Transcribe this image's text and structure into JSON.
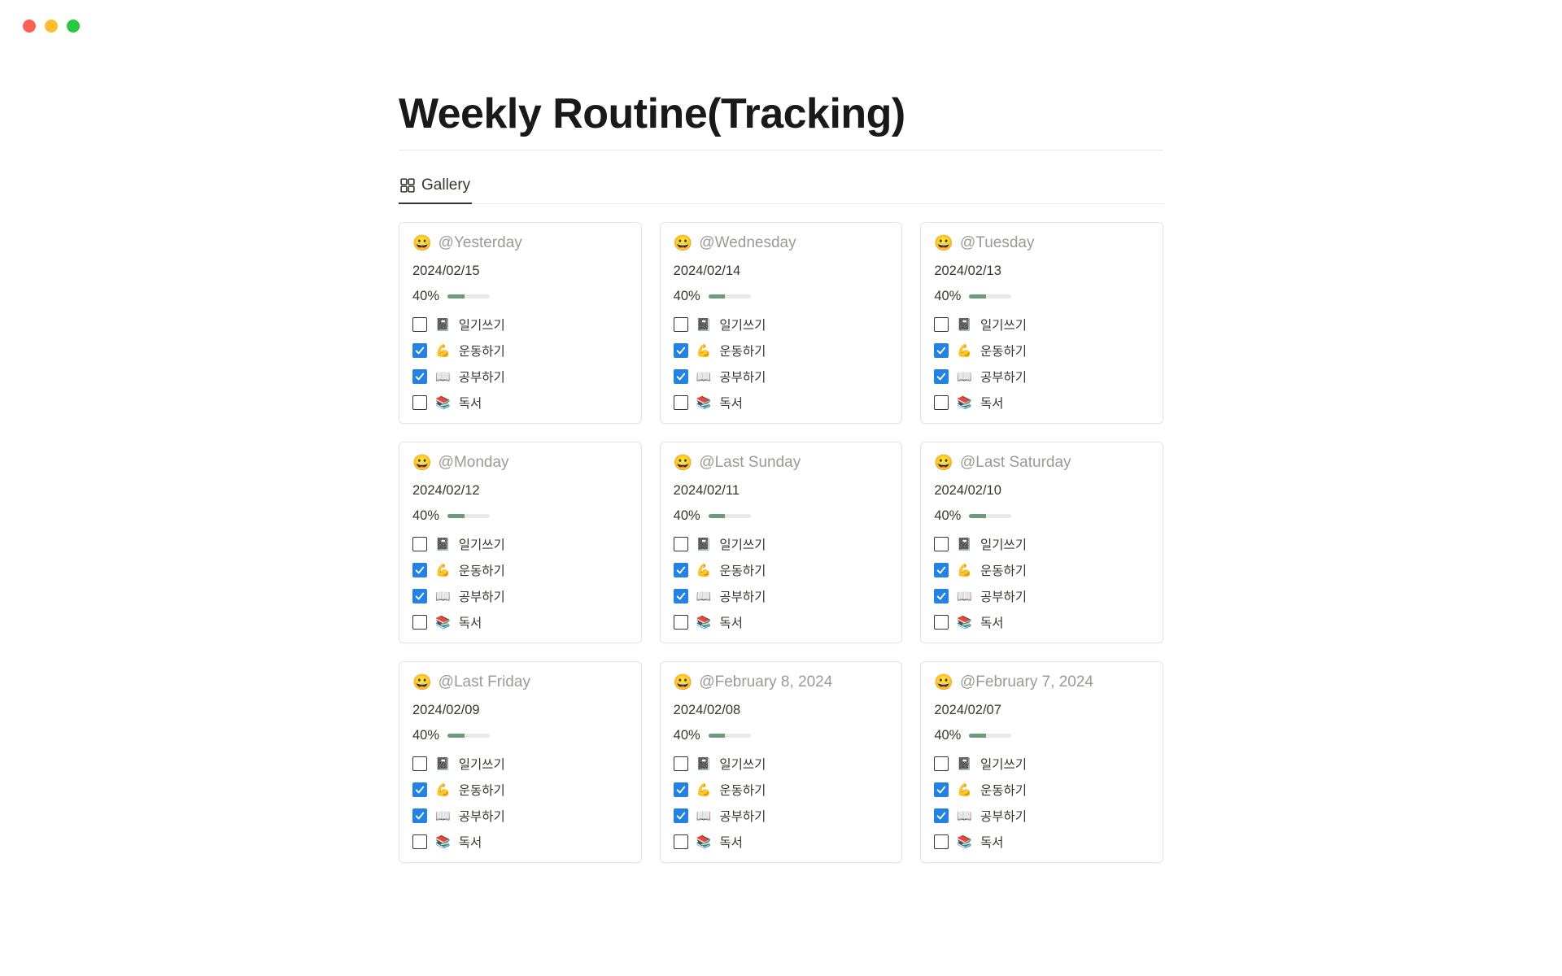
{
  "page": {
    "title": "Weekly Routine(Tracking)"
  },
  "tabs": {
    "gallery_label": "Gallery"
  },
  "cards": [
    {
      "emoji": "😀",
      "title": "@Yesterday",
      "date": "2024/02/15",
      "percent": "40%",
      "progress": 40,
      "tasks": [
        {
          "checked": false,
          "emoji": "📓",
          "text": "일기쓰기"
        },
        {
          "checked": true,
          "emoji": "💪",
          "text": "운동하기"
        },
        {
          "checked": true,
          "emoji": "📖",
          "text": "공부하기"
        },
        {
          "checked": false,
          "emoji": "📚",
          "text": "독서"
        }
      ]
    },
    {
      "emoji": "😀",
      "title": "@Wednesday",
      "date": "2024/02/14",
      "percent": "40%",
      "progress": 40,
      "tasks": [
        {
          "checked": false,
          "emoji": "📓",
          "text": "일기쓰기"
        },
        {
          "checked": true,
          "emoji": "💪",
          "text": "운동하기"
        },
        {
          "checked": true,
          "emoji": "📖",
          "text": "공부하기"
        },
        {
          "checked": false,
          "emoji": "📚",
          "text": "독서"
        }
      ]
    },
    {
      "emoji": "😀",
      "title": "@Tuesday",
      "date": "2024/02/13",
      "percent": "40%",
      "progress": 40,
      "tasks": [
        {
          "checked": false,
          "emoji": "📓",
          "text": "일기쓰기"
        },
        {
          "checked": true,
          "emoji": "💪",
          "text": "운동하기"
        },
        {
          "checked": true,
          "emoji": "📖",
          "text": "공부하기"
        },
        {
          "checked": false,
          "emoji": "📚",
          "text": "독서"
        }
      ]
    },
    {
      "emoji": "😀",
      "title": "@Monday",
      "date": "2024/02/12",
      "percent": "40%",
      "progress": 40,
      "tasks": [
        {
          "checked": false,
          "emoji": "📓",
          "text": "일기쓰기"
        },
        {
          "checked": true,
          "emoji": "💪",
          "text": "운동하기"
        },
        {
          "checked": true,
          "emoji": "📖",
          "text": "공부하기"
        },
        {
          "checked": false,
          "emoji": "📚",
          "text": "독서"
        }
      ]
    },
    {
      "emoji": "😀",
      "title": "@Last Sunday",
      "date": "2024/02/11",
      "percent": "40%",
      "progress": 40,
      "tasks": [
        {
          "checked": false,
          "emoji": "📓",
          "text": "일기쓰기"
        },
        {
          "checked": true,
          "emoji": "💪",
          "text": "운동하기"
        },
        {
          "checked": true,
          "emoji": "📖",
          "text": "공부하기"
        },
        {
          "checked": false,
          "emoji": "📚",
          "text": "독서"
        }
      ]
    },
    {
      "emoji": "😀",
      "title": "@Last Saturday",
      "date": "2024/02/10",
      "percent": "40%",
      "progress": 40,
      "tasks": [
        {
          "checked": false,
          "emoji": "📓",
          "text": "일기쓰기"
        },
        {
          "checked": true,
          "emoji": "💪",
          "text": "운동하기"
        },
        {
          "checked": true,
          "emoji": "📖",
          "text": "공부하기"
        },
        {
          "checked": false,
          "emoji": "📚",
          "text": "독서"
        }
      ]
    },
    {
      "emoji": "😀",
      "title": "@Last Friday",
      "date": "2024/02/09",
      "percent": "40%",
      "progress": 40,
      "tasks": [
        {
          "checked": false,
          "emoji": "📓",
          "text": "일기쓰기"
        },
        {
          "checked": true,
          "emoji": "💪",
          "text": "운동하기"
        },
        {
          "checked": true,
          "emoji": "📖",
          "text": "공부하기"
        },
        {
          "checked": false,
          "emoji": "📚",
          "text": "독서"
        }
      ]
    },
    {
      "emoji": "😀",
      "title": "@February 8, 2024",
      "date": "2024/02/08",
      "percent": "40%",
      "progress": 40,
      "tasks": [
        {
          "checked": false,
          "emoji": "📓",
          "text": "일기쓰기"
        },
        {
          "checked": true,
          "emoji": "💪",
          "text": "운동하기"
        },
        {
          "checked": true,
          "emoji": "📖",
          "text": "공부하기"
        },
        {
          "checked": false,
          "emoji": "📚",
          "text": "독서"
        }
      ]
    },
    {
      "emoji": "😀",
      "title": "@February 7, 2024",
      "date": "2024/02/07",
      "percent": "40%",
      "progress": 40,
      "tasks": [
        {
          "checked": false,
          "emoji": "📓",
          "text": "일기쓰기"
        },
        {
          "checked": true,
          "emoji": "💪",
          "text": "운동하기"
        },
        {
          "checked": true,
          "emoji": "📖",
          "text": "공부하기"
        },
        {
          "checked": false,
          "emoji": "📚",
          "text": "독서"
        }
      ]
    }
  ]
}
